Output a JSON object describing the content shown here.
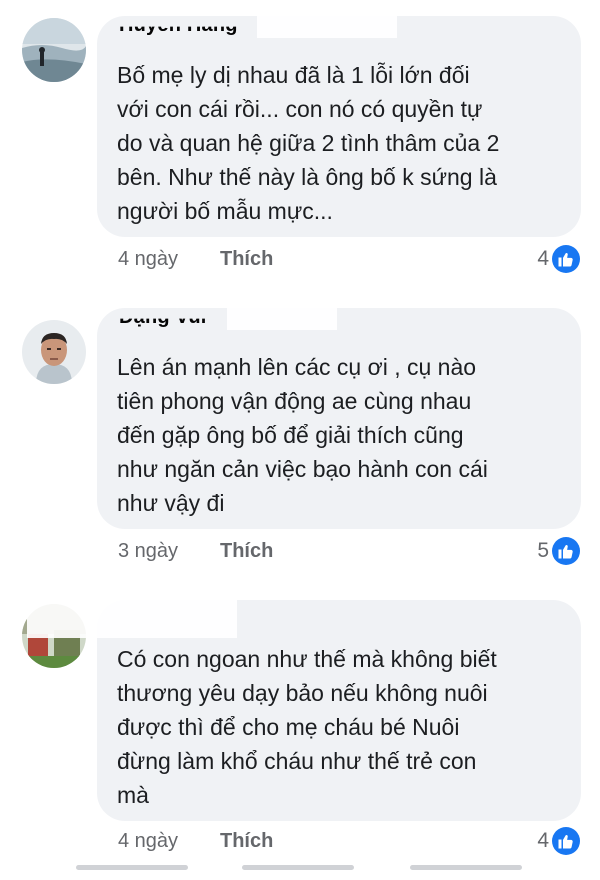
{
  "comments": [
    {
      "author_visible": "Huyền Hằng",
      "text": "Bố mẹ ly dị nhau đã là 1 lỗi lớn đối\nvới con cái rồi... con nó có quyền tự\ndo và quan hệ giữa 2 tình thâm của 2\nbên. Như thế này là ông bố k sứng là\nngười bố mẫu mực...",
      "time": "4 ngày",
      "like_label": "Thích",
      "reaction_count": "4",
      "reaction_icon": "like-icon"
    },
    {
      "author_visible": "Đặng Vui",
      "text": "Lên án mạnh lên các cụ ơi , cụ nào\ntiên phong vận động ae cùng nhau\nđến gặp ông bố để giải thích cũng\nnhư ngăn cản việc bạo hành con cái\nnhư vậy đi",
      "time": "3 ngày",
      "like_label": "Thích",
      "reaction_count": "5",
      "reaction_icon": "like-icon"
    },
    {
      "author_visible": "",
      "text": "Có con ngoan như thế mà không biết\nthương yêu dạy bảo nếu không nuôi\nđược thì để cho mẹ cháu bé Nuôi\nđừng làm khổ cháu như thế trẻ con\nmà",
      "time": "4 ngày",
      "like_label": "Thích",
      "reaction_count": "4",
      "reaction_icon": "like-icon"
    }
  ],
  "colors": {
    "bubble": "#f0f2f5",
    "meta_text": "#65676b",
    "like_blue": "#1877f2"
  }
}
